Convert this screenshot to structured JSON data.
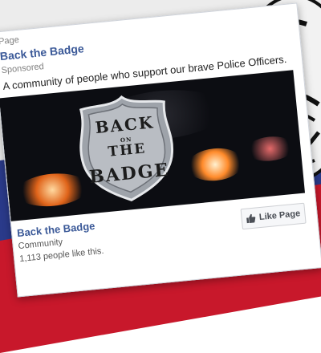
{
  "ad": {
    "meta": "Page",
    "page_name": "Back the Badge",
    "sponsored": "Sponsored",
    "post_text": "A community of people who support our brave Police Officers.",
    "image": {
      "title_line1": "BACK",
      "title_on": "ON",
      "title_line2": "THE",
      "title_line3": "BADGE"
    },
    "footer": {
      "page_name": "Back the Badge",
      "category": "Community",
      "likes": "1,113 people like this."
    },
    "like_button_label": "Like Page"
  },
  "colors": {
    "facebook_blue": "#3b5998",
    "flag_red": "#c8182b",
    "flag_blue": "#2a3a8a"
  },
  "icons": {
    "like": "thumbs-up-icon"
  }
}
